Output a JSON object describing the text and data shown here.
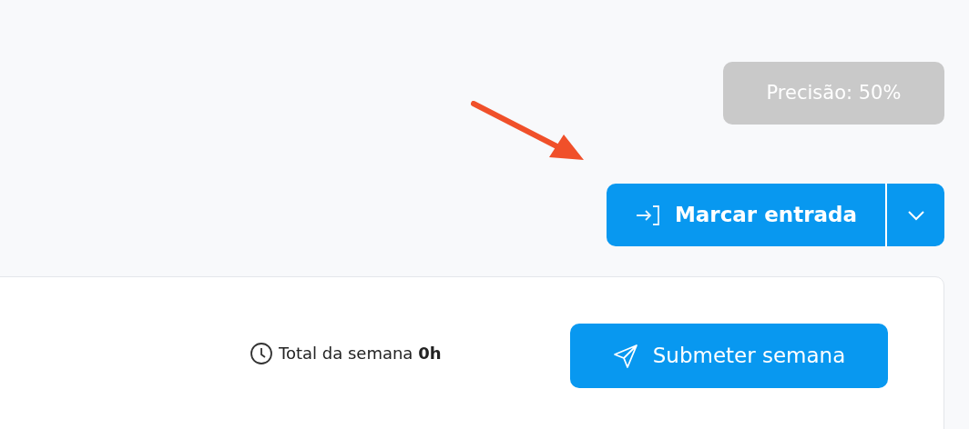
{
  "accuracy_badge": {
    "label": "Precisão: 50%"
  },
  "clock_in_button": {
    "label": "Marcar entrada"
  },
  "week_summary": {
    "text": "Total da semana **0h**"
  },
  "submit_button": {
    "label": "Submeter semana"
  }
}
